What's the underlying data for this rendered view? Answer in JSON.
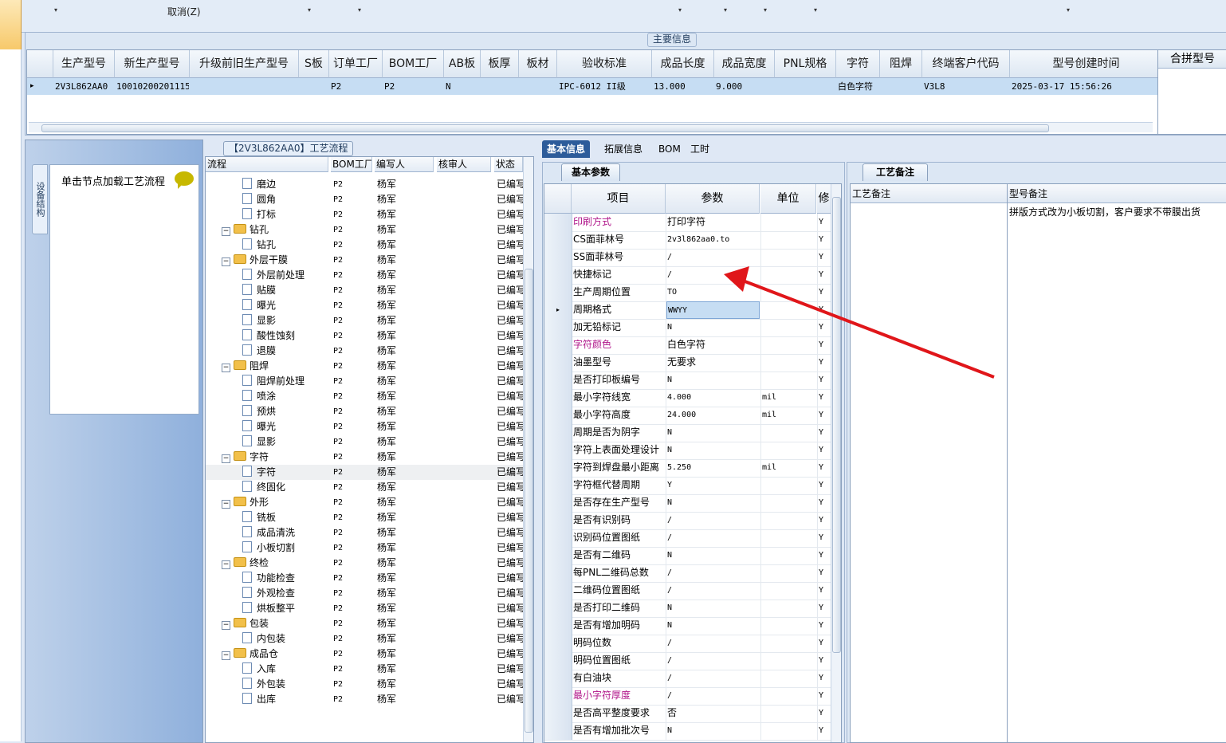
{
  "toolbar": {
    "cancel_label": "取消(Z)"
  },
  "main_info": {
    "section_label": "主要信息",
    "columns": [
      "生产型号",
      "新生产型号",
      "升级前旧生产型号",
      "S板",
      "订单工厂",
      "BOM工厂",
      "AB板",
      "板厚",
      "板材",
      "验收标准",
      "成品长度",
      "成品宽度",
      "PNL规格",
      "字符",
      "阻焊",
      "终端客户代码",
      "型号创建时间"
    ],
    "row": [
      "2V3L862AA0",
      "10010200201115",
      "",
      "",
      "P2",
      "P2",
      "N",
      "",
      "",
      "IPC-6012 II级",
      "13.000",
      "9.000",
      "",
      "白色字符",
      "",
      "V3L8",
      "2025-03-17 15:56:26"
    ],
    "merge_label": "合拼型号"
  },
  "left_panel": {
    "vertical_tab": "设备结构",
    "click_hint": "单击节点加载工艺流程"
  },
  "process_tree": {
    "title": "【2V3L862AA0】工艺流程",
    "headers": [
      "流程",
      "BOM工厂",
      "编写人",
      "核审人",
      "状态"
    ],
    "rows": [
      {
        "level": 2,
        "name": "磨边",
        "factory": "P2",
        "writer": "杨军",
        "reviewer": "",
        "status": "已编写"
      },
      {
        "level": 2,
        "name": "圆角",
        "factory": "P2",
        "writer": "杨军",
        "reviewer": "",
        "status": "已编写"
      },
      {
        "level": 2,
        "name": "打标",
        "factory": "P2",
        "writer": "杨军",
        "reviewer": "",
        "status": "已编写"
      },
      {
        "level": 1,
        "name": "钻孔",
        "factory": "P2",
        "writer": "杨军",
        "reviewer": "",
        "status": "已编写"
      },
      {
        "level": 2,
        "name": "钻孔",
        "factory": "P2",
        "writer": "杨军",
        "reviewer": "",
        "status": "已编写"
      },
      {
        "level": 1,
        "name": "外层干膜",
        "factory": "P2",
        "writer": "杨军",
        "reviewer": "",
        "status": "已编写"
      },
      {
        "level": 2,
        "name": "外层前处理",
        "factory": "P2",
        "writer": "杨军",
        "reviewer": "",
        "status": "已编写"
      },
      {
        "level": 2,
        "name": "贴膜",
        "factory": "P2",
        "writer": "杨军",
        "reviewer": "",
        "status": "已编写"
      },
      {
        "level": 2,
        "name": "曝光",
        "factory": "P2",
        "writer": "杨军",
        "reviewer": "",
        "status": "已编写"
      },
      {
        "level": 2,
        "name": "显影",
        "factory": "P2",
        "writer": "杨军",
        "reviewer": "",
        "status": "已编写"
      },
      {
        "level": 2,
        "name": "酸性蚀刻",
        "factory": "P2",
        "writer": "杨军",
        "reviewer": "",
        "status": "已编写"
      },
      {
        "level": 2,
        "name": "退膜",
        "factory": "P2",
        "writer": "杨军",
        "reviewer": "",
        "status": "已编写"
      },
      {
        "level": 1,
        "name": "阻焊",
        "factory": "P2",
        "writer": "杨军",
        "reviewer": "",
        "status": "已编写"
      },
      {
        "level": 2,
        "name": "阻焊前处理",
        "factory": "P2",
        "writer": "杨军",
        "reviewer": "",
        "status": "已编写"
      },
      {
        "level": 2,
        "name": "喷涂",
        "factory": "P2",
        "writer": "杨军",
        "reviewer": "",
        "status": "已编写"
      },
      {
        "level": 2,
        "name": "预烘",
        "factory": "P2",
        "writer": "杨军",
        "reviewer": "",
        "status": "已编写"
      },
      {
        "level": 2,
        "name": "曝光",
        "factory": "P2",
        "writer": "杨军",
        "reviewer": "",
        "status": "已编写"
      },
      {
        "level": 2,
        "name": "显影",
        "factory": "P2",
        "writer": "杨军",
        "reviewer": "",
        "status": "已编写"
      },
      {
        "level": 1,
        "name": "字符",
        "factory": "P2",
        "writer": "杨军",
        "reviewer": "",
        "status": "已编写"
      },
      {
        "level": 2,
        "name": "字符",
        "factory": "P2",
        "writer": "杨军",
        "reviewer": "",
        "status": "已编写",
        "selected": true
      },
      {
        "level": 2,
        "name": "终固化",
        "factory": "P2",
        "writer": "杨军",
        "reviewer": "",
        "status": "已编写"
      },
      {
        "level": 1,
        "name": "外形",
        "factory": "P2",
        "writer": "杨军",
        "reviewer": "",
        "status": "已编写"
      },
      {
        "level": 2,
        "name": "铣板",
        "factory": "P2",
        "writer": "杨军",
        "reviewer": "",
        "status": "已编写"
      },
      {
        "level": 2,
        "name": "成品清洗",
        "factory": "P2",
        "writer": "杨军",
        "reviewer": "",
        "status": "已编写"
      },
      {
        "level": 2,
        "name": "小板切割",
        "factory": "P2",
        "writer": "杨军",
        "reviewer": "",
        "status": "已编写"
      },
      {
        "level": 1,
        "name": "终检",
        "factory": "P2",
        "writer": "杨军",
        "reviewer": "",
        "status": "已编写"
      },
      {
        "level": 2,
        "name": "功能检查",
        "factory": "P2",
        "writer": "杨军",
        "reviewer": "",
        "status": "已编写"
      },
      {
        "level": 2,
        "name": "外观检查",
        "factory": "P2",
        "writer": "杨军",
        "reviewer": "",
        "status": "已编写"
      },
      {
        "level": 2,
        "name": "烘板整平",
        "factory": "P2",
        "writer": "杨军",
        "reviewer": "",
        "status": "已编写"
      },
      {
        "level": 1,
        "name": "包装",
        "factory": "P2",
        "writer": "杨军",
        "reviewer": "",
        "status": "已编写"
      },
      {
        "level": 2,
        "name": "内包装",
        "factory": "P2",
        "writer": "杨军",
        "reviewer": "",
        "status": "已编写"
      },
      {
        "level": 1,
        "name": "成品仓",
        "factory": "P2",
        "writer": "杨军",
        "reviewer": "",
        "status": "已编写"
      },
      {
        "level": 2,
        "name": "入库",
        "factory": "P2",
        "writer": "杨军",
        "reviewer": "",
        "status": "已编写"
      },
      {
        "level": 2,
        "name": "外包装",
        "factory": "P2",
        "writer": "杨军",
        "reviewer": "",
        "status": "已编写"
      },
      {
        "level": 2,
        "name": "出库",
        "factory": "P2",
        "writer": "杨军",
        "reviewer": "",
        "status": "已编写"
      }
    ]
  },
  "tabs": [
    "基本信息",
    "拓展信息",
    "BOM",
    "工时"
  ],
  "basic_params": {
    "tab_label": "基本参数",
    "headers": [
      "项目",
      "参数",
      "单位",
      "修"
    ],
    "rows": [
      {
        "item": "印刷方式",
        "value": "打印字符",
        "unit": "",
        "mod": "Y",
        "pink": true
      },
      {
        "item": "CS面菲林号",
        "value": "2v3l862aa0.to",
        "unit": "",
        "mod": "Y"
      },
      {
        "item": "SS面菲林号",
        "value": "/",
        "unit": "",
        "mod": "Y"
      },
      {
        "item": "快捷标记",
        "value": "/",
        "unit": "",
        "mod": "Y"
      },
      {
        "item": "生产周期位置",
        "value": "TO",
        "unit": "",
        "mod": "Y"
      },
      {
        "item": "周期格式",
        "value": "WWYY",
        "unit": "",
        "mod": "Y",
        "current": true
      },
      {
        "item": "加无铅标记",
        "value": "N",
        "unit": "",
        "mod": "Y"
      },
      {
        "item": "字符颜色",
        "value": "白色字符",
        "unit": "",
        "mod": "Y",
        "pink": true
      },
      {
        "item": "油墨型号",
        "value": "无要求",
        "unit": "",
        "mod": "Y"
      },
      {
        "item": "是否打印板编号",
        "value": "N",
        "unit": "",
        "mod": "Y"
      },
      {
        "item": "最小字符线宽",
        "value": "4.000",
        "unit": "mil",
        "mod": "Y"
      },
      {
        "item": "最小字符高度",
        "value": "24.000",
        "unit": "mil",
        "mod": "Y"
      },
      {
        "item": "周期是否为阴字",
        "value": "N",
        "unit": "",
        "mod": "Y"
      },
      {
        "item": "字符上表面处理设计",
        "value": "N",
        "unit": "",
        "mod": "Y"
      },
      {
        "item": "字符到焊盘最小距离",
        "value": "5.250",
        "unit": "mil",
        "mod": "Y"
      },
      {
        "item": "字符框代替周期",
        "value": "Y",
        "unit": "",
        "mod": "Y"
      },
      {
        "item": "是否存在生产型号",
        "value": "N",
        "unit": "",
        "mod": "Y"
      },
      {
        "item": "是否有识别码",
        "value": "/",
        "unit": "",
        "mod": "Y"
      },
      {
        "item": "识别码位置图纸",
        "value": "/",
        "unit": "",
        "mod": "Y"
      },
      {
        "item": "是否有二维码",
        "value": "N",
        "unit": "",
        "mod": "Y"
      },
      {
        "item": "每PNL二维码总数",
        "value": "/",
        "unit": "",
        "mod": "Y"
      },
      {
        "item": "二维码位置图纸",
        "value": "/",
        "unit": "",
        "mod": "Y"
      },
      {
        "item": "是否打印二维码",
        "value": "N",
        "unit": "",
        "mod": "Y"
      },
      {
        "item": "是否有增加明码",
        "value": "N",
        "unit": "",
        "mod": "Y"
      },
      {
        "item": "明码位数",
        "value": "/",
        "unit": "",
        "mod": "Y"
      },
      {
        "item": "明码位置图纸",
        "value": "/",
        "unit": "",
        "mod": "Y"
      },
      {
        "item": "有白油块",
        "value": "/",
        "unit": "",
        "mod": "Y"
      },
      {
        "item": "最小字符厚度",
        "value": "/",
        "unit": "",
        "mod": "Y",
        "pink": true
      },
      {
        "item": "是否高平整度要求",
        "value": "否",
        "unit": "",
        "mod": "Y"
      },
      {
        "item": "是否有增加批次号",
        "value": "N",
        "unit": "",
        "mod": "Y"
      }
    ]
  },
  "process_notes": {
    "tab_label": "工艺备注",
    "left_header": "工艺备注",
    "right_header": "型号备注",
    "model_note": "拼版方式改为小板切割，客户要求不带膜出货"
  },
  "colors": {
    "arrow": "#e0161a",
    "pink_label": "#b0168a",
    "active_tab": "#2d5c9a",
    "row_selected": "#c6ddf3"
  }
}
